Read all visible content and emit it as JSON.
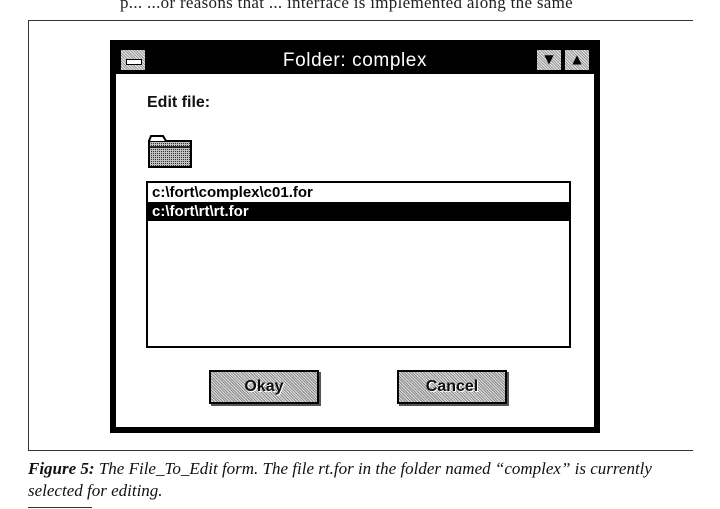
{
  "page": {
    "top_text": "p... ...or reasons that ... interface is implemented along the same"
  },
  "dialog": {
    "title": "Folder: complex",
    "edit_label": "Edit file:",
    "files": [
      {
        "path": "c:\\fort\\complex\\c01.for",
        "selected": false
      },
      {
        "path": "c:\\fort\\rt\\rt.for",
        "selected": true
      }
    ],
    "ok_label": "Okay",
    "cancel_label": "Cancel",
    "min_symbol": "▼",
    "max_symbol": "▲"
  },
  "caption": {
    "figure_label": "Figure 5:",
    "text": "The File_To_Edit form. The file rt.for in the folder named “complex” is currently selected for editing."
  }
}
